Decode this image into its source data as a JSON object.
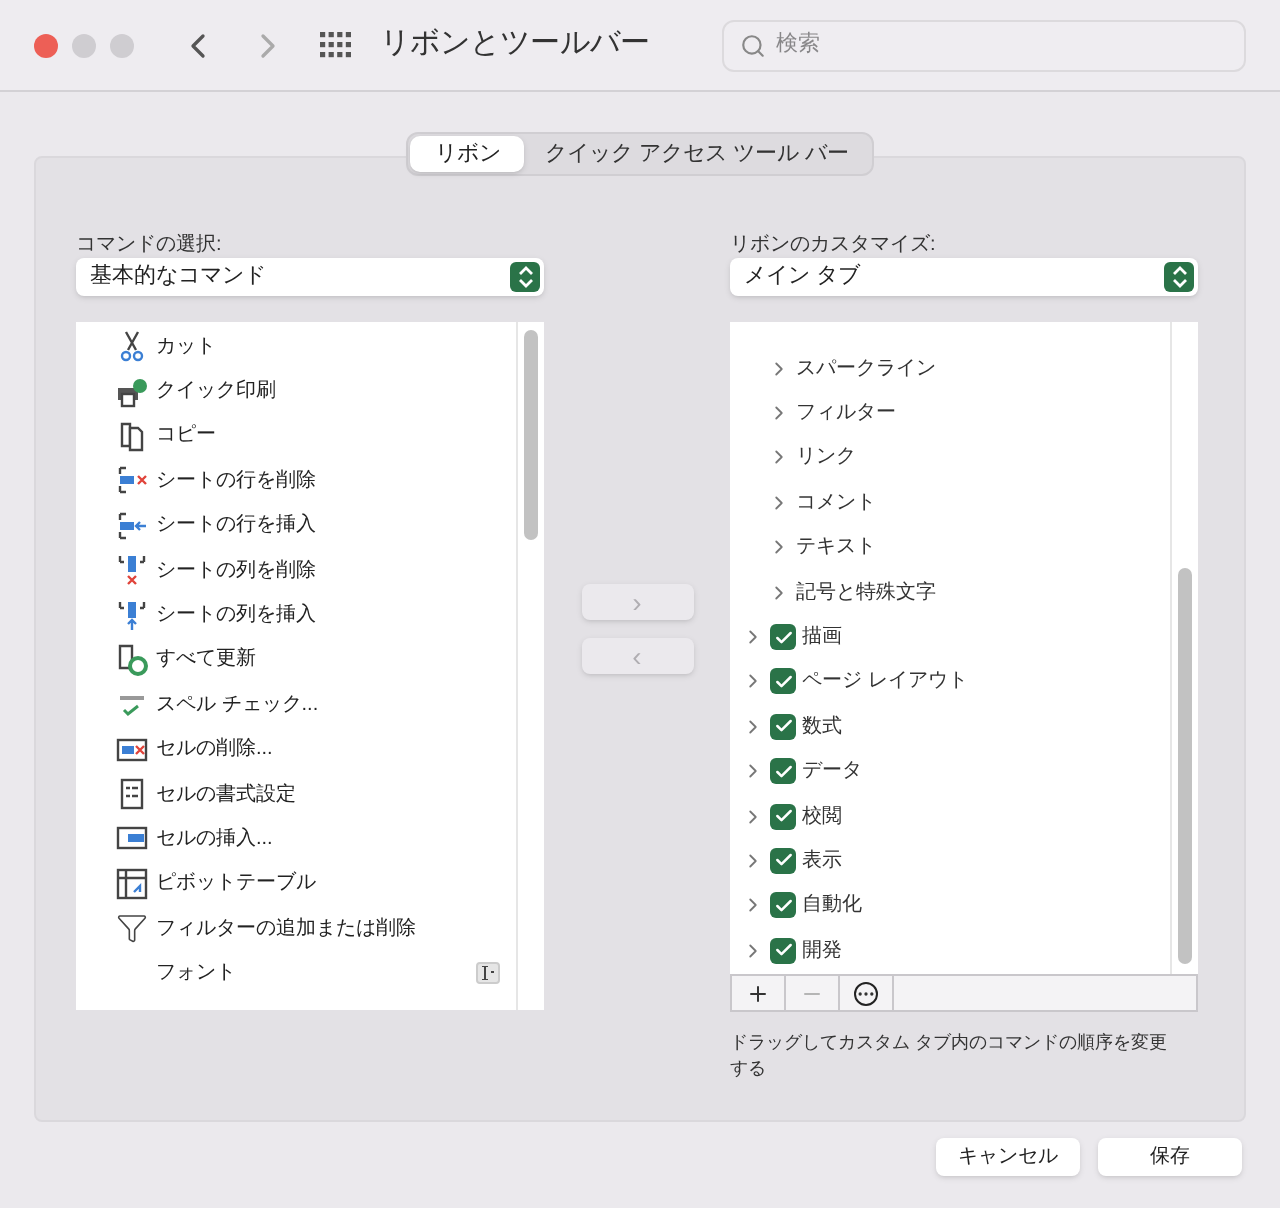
{
  "window": {
    "title": "リボンとツールバー",
    "search_placeholder": "検索"
  },
  "tabs": [
    {
      "label": "リボン",
      "selected": true
    },
    {
      "label": "クイック アクセス ツール バー",
      "selected": false
    }
  ],
  "commands": {
    "label": "コマンドの選択:",
    "dropdown": "基本的なコマンド",
    "items": [
      {
        "label": "カット",
        "kind": "cut"
      },
      {
        "label": "クイック印刷",
        "kind": "print"
      },
      {
        "label": "コピー",
        "kind": "copy"
      },
      {
        "label": "シートの行を削除",
        "kind": "row-delete"
      },
      {
        "label": "シートの行を挿入",
        "kind": "row-insert"
      },
      {
        "label": "シートの列を削除",
        "kind": "col-delete"
      },
      {
        "label": "シートの列を挿入",
        "kind": "col-insert"
      },
      {
        "label": "すべて更新",
        "kind": "refresh"
      },
      {
        "label": "スペル チェック...",
        "kind": "spell"
      },
      {
        "label": "セルの削除...",
        "kind": "cell-delete"
      },
      {
        "label": "セルの書式設定",
        "kind": "format"
      },
      {
        "label": "セルの挿入...",
        "kind": "cell-insert"
      },
      {
        "label": "ピボットテーブル",
        "kind": "pivot"
      },
      {
        "label": "フィルターの追加または削除",
        "kind": "filter"
      },
      {
        "label": "フォント",
        "kind": "font"
      }
    ]
  },
  "move_buttons": [
    {
      "symbol": "›",
      "disabled": true
    },
    {
      "symbol": "‹",
      "disabled": true
    }
  ],
  "ribbon": {
    "label": "リボンのカスタマイズ:",
    "dropdown": "メイン タブ",
    "items": [
      {
        "label": "スパークライン",
        "kind": "group"
      },
      {
        "label": "フィルター",
        "kind": "group"
      },
      {
        "label": "リンク",
        "kind": "group"
      },
      {
        "label": "コメント",
        "kind": "group"
      },
      {
        "label": "テキスト",
        "kind": "group"
      },
      {
        "label": "記号と特殊文字",
        "kind": "group"
      },
      {
        "label": "描画",
        "kind": "tab",
        "checked": true
      },
      {
        "label": "ページ レイアウト",
        "kind": "tab",
        "checked": true
      },
      {
        "label": "数式",
        "kind": "tab",
        "checked": true
      },
      {
        "label": "データ",
        "kind": "tab",
        "checked": true
      },
      {
        "label": "校閲",
        "kind": "tab",
        "checked": true
      },
      {
        "label": "表示",
        "kind": "tab",
        "checked": true
      },
      {
        "label": "自動化",
        "kind": "tab",
        "checked": true
      },
      {
        "label": "開発",
        "kind": "tab",
        "checked": true
      }
    ],
    "toolbar": [
      {
        "kind": "add",
        "disabled": false
      },
      {
        "kind": "remove",
        "disabled": true
      },
      {
        "kind": "more",
        "disabled": false
      }
    ],
    "hint": "ドラッグしてカスタム タブ内のコマンドの順序を変更する"
  },
  "buttons": [
    {
      "label": "キャンセル"
    },
    {
      "label": "保存"
    }
  ]
}
